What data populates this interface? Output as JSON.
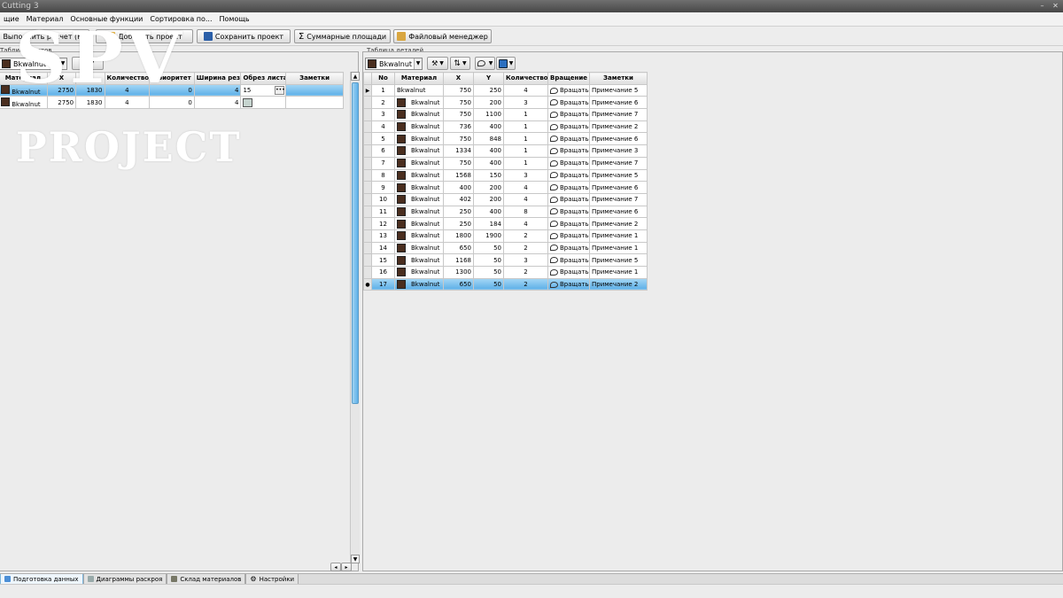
{
  "window": {
    "title": "Cutting 3"
  },
  "menu": [
    "щие",
    "Материал",
    "Основные функции",
    "Сортировка по...",
    "Помощь"
  ],
  "toolbar": {
    "run_label": "Выполнить расчет (F9)",
    "add_label": "Добавить проект",
    "save_label": "Сохранить проект",
    "sum_label": "Суммарные площади",
    "files_label": "Файловый менеджер"
  },
  "left_panel": {
    "label": "Таблица листов",
    "material_select": "Bkwalnut",
    "columns": [
      "Материал",
      "X",
      "Y",
      "Количество",
      "Приоритет",
      "Ширина реза",
      "Обрез листа",
      "Заметки"
    ],
    "rows": [
      {
        "material": "Bkwalnut",
        "x": "2750",
        "y": "1830",
        "qty": "4",
        "priority": "0",
        "kerf": "4",
        "trim": "15",
        "notes": ""
      },
      {
        "material": "Bkwalnut",
        "x": "2750",
        "y": "1830",
        "qty": "4",
        "priority": "0",
        "kerf": "4",
        "trim": "",
        "notes": ""
      }
    ]
  },
  "right_panel": {
    "label": "Таблица деталей",
    "material_select": "Bkwalnut",
    "columns": [
      "No",
      "Материал",
      "X",
      "Y",
      "Количество",
      "Вращение",
      "Заметки"
    ],
    "rows": [
      {
        "no": "1",
        "material": "Bkwalnut",
        "x": "750",
        "y": "250",
        "qty": "4",
        "rot": "Вращать",
        "notes": "Примечание 5"
      },
      {
        "no": "2",
        "material": "Bkwalnut",
        "x": "750",
        "y": "200",
        "qty": "3",
        "rot": "Вращать",
        "notes": "Примечание 6"
      },
      {
        "no": "3",
        "material": "Bkwalnut",
        "x": "750",
        "y": "1100",
        "qty": "1",
        "rot": "Вращать",
        "notes": "Примечание 7"
      },
      {
        "no": "4",
        "material": "Bkwalnut",
        "x": "736",
        "y": "400",
        "qty": "1",
        "rot": "Вращать",
        "notes": "Примечание 2"
      },
      {
        "no": "5",
        "material": "Bkwalnut",
        "x": "750",
        "y": "848",
        "qty": "1",
        "rot": "Вращать",
        "notes": "Примечание 6"
      },
      {
        "no": "6",
        "material": "Bkwalnut",
        "x": "1334",
        "y": "400",
        "qty": "1",
        "rot": "Вращать",
        "notes": "Примечание 3"
      },
      {
        "no": "7",
        "material": "Bkwalnut",
        "x": "750",
        "y": "400",
        "qty": "1",
        "rot": "Вращать",
        "notes": "Примечание 7"
      },
      {
        "no": "8",
        "material": "Bkwalnut",
        "x": "1568",
        "y": "150",
        "qty": "3",
        "rot": "Вращать",
        "notes": "Примечание 5"
      },
      {
        "no": "9",
        "material": "Bkwalnut",
        "x": "400",
        "y": "200",
        "qty": "4",
        "rot": "Вращать",
        "notes": "Примечание 6"
      },
      {
        "no": "10",
        "material": "Bkwalnut",
        "x": "402",
        "y": "200",
        "qty": "4",
        "rot": "Вращать",
        "notes": "Примечание 7"
      },
      {
        "no": "11",
        "material": "Bkwalnut",
        "x": "250",
        "y": "400",
        "qty": "8",
        "rot": "Вращать",
        "notes": "Примечание 6"
      },
      {
        "no": "12",
        "material": "Bkwalnut",
        "x": "250",
        "y": "184",
        "qty": "4",
        "rot": "Вращать",
        "notes": "Примечание 2"
      },
      {
        "no": "13",
        "material": "Bkwalnut",
        "x": "1800",
        "y": "1900",
        "qty": "2",
        "rot": "Вращать",
        "notes": "Примечание 1"
      },
      {
        "no": "14",
        "material": "Bkwalnut",
        "x": "650",
        "y": "50",
        "qty": "2",
        "rot": "Вращать",
        "notes": "Примечание 1"
      },
      {
        "no": "15",
        "material": "Bkwalnut",
        "x": "1168",
        "y": "50",
        "qty": "3",
        "rot": "Вращать",
        "notes": "Примечание 5"
      },
      {
        "no": "16",
        "material": "Bkwalnut",
        "x": "1300",
        "y": "50",
        "qty": "2",
        "rot": "Вращать",
        "notes": "Примечание 1"
      },
      {
        "no": "17",
        "material": "Bkwalnut",
        "x": "650",
        "y": "50",
        "qty": "2",
        "rot": "Вращать",
        "notes": "Примечание 2"
      }
    ]
  },
  "tabs": [
    "Подготовка данных",
    "Диаграммы раскроя",
    "Склад материалов",
    "Настройки"
  ],
  "watermark": {
    "line1": "SPV",
    "line2": "PROJECT"
  },
  "colors": {
    "swatch": "#4a2e1f",
    "selection": "#5fb0e8"
  }
}
